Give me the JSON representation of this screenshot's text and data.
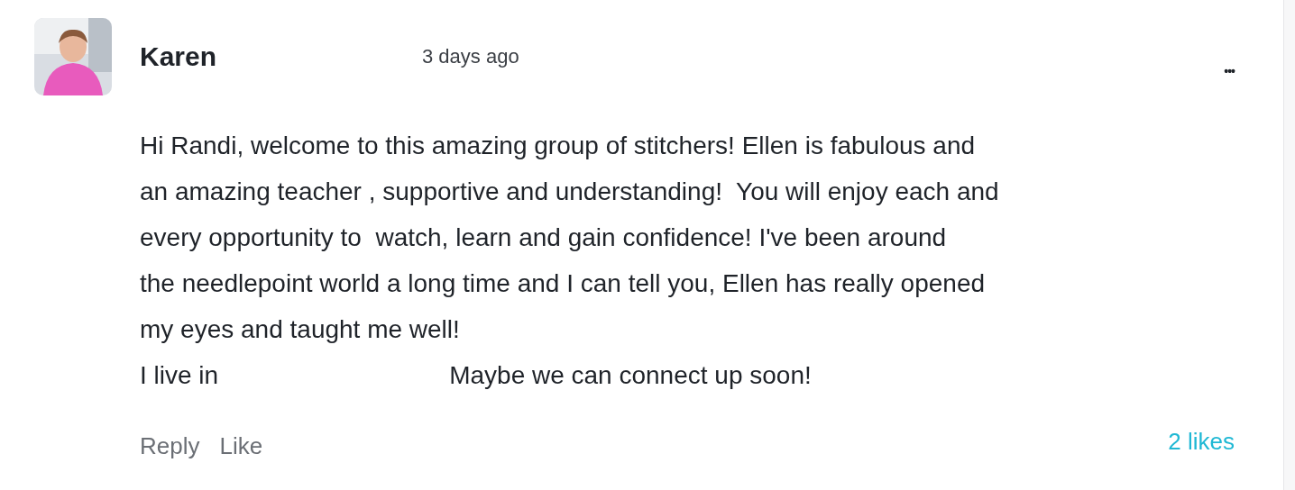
{
  "comment": {
    "author": "Karen",
    "time": "3 days ago",
    "more": "•••",
    "body_lines": [
      "Hi Randi, welcome to this amazing group of stitchers! Ellen is fabulous and",
      "an amazing teacher , supportive and understanding!  You will enjoy each and",
      "every opportunity to  watch, learn and gain confidence! I've been around",
      "the needlepoint world a long time and I can tell you, Ellen has really opened",
      "my eyes and taught me well!"
    ],
    "last_line": [
      "I live in",
      "Maybe we can connect up soon!"
    ],
    "actions": [
      "Reply",
      "Like"
    ],
    "likes": "2 likes"
  }
}
